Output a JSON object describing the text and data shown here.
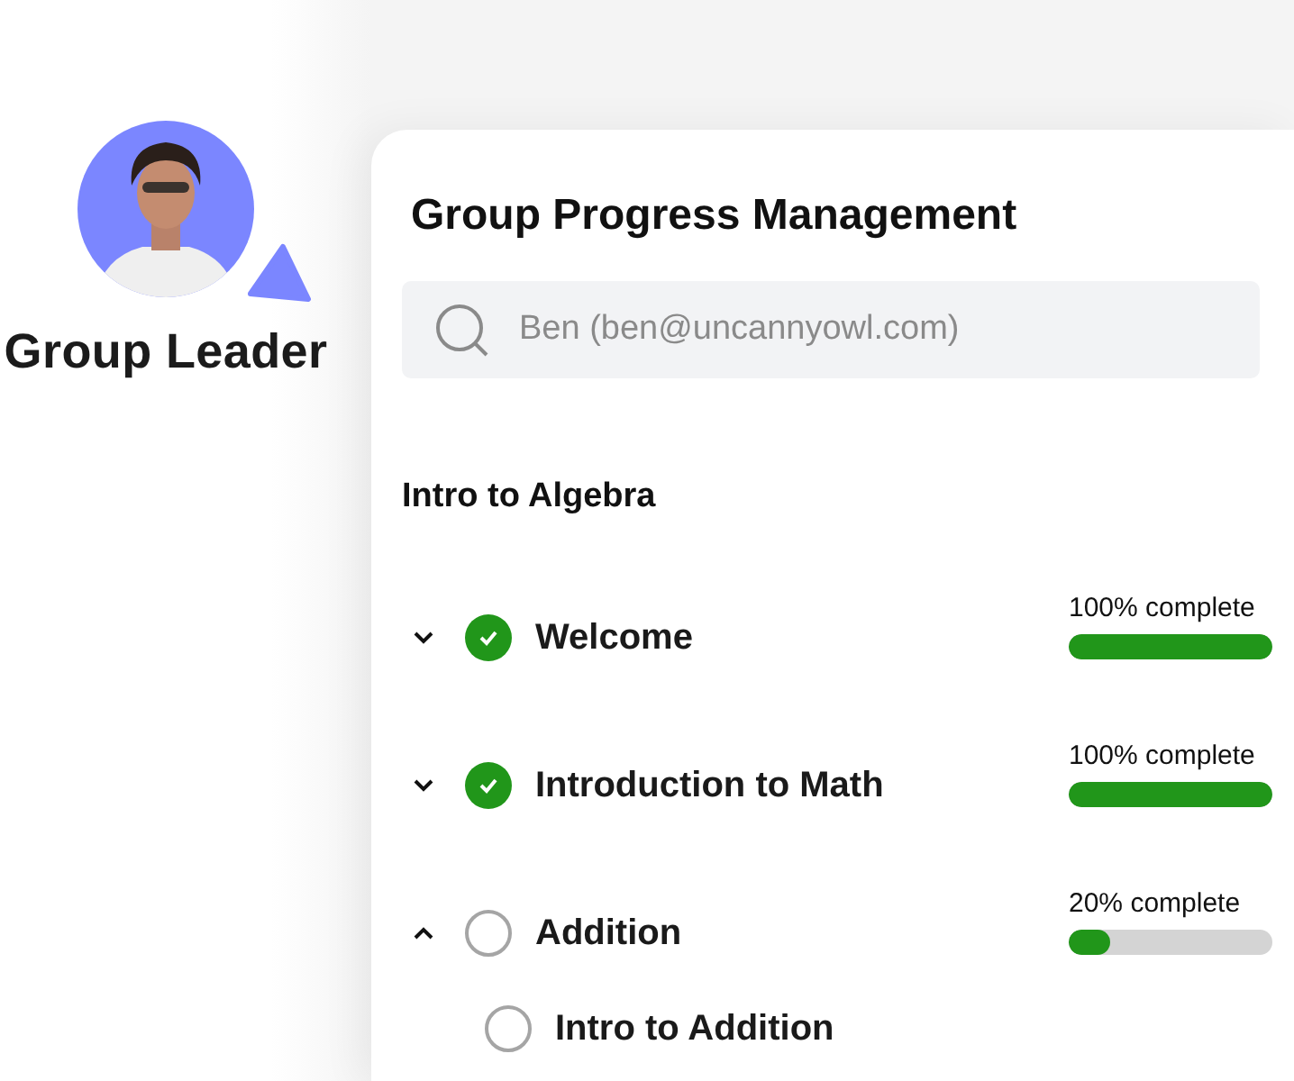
{
  "leader": {
    "label": "Group Leader"
  },
  "panel": {
    "title": "Group Progress Management",
    "search": {
      "value": "Ben (ben@uncannyowl.com)"
    },
    "course": "Intro to Algebra",
    "lessons": [
      {
        "title": "Welcome",
        "completed": true,
        "expanded": false,
        "progress": "100% complete",
        "level": 1.0
      },
      {
        "title": "Introduction to Math",
        "completed": true,
        "expanded": false,
        "progress": "100% complete",
        "level": 1.0
      },
      {
        "title": "Addition",
        "completed": false,
        "expanded": true,
        "progress": "20% complete",
        "level": 0.2,
        "children": [
          {
            "title": "Intro to Addition",
            "completed": false
          }
        ]
      }
    ]
  }
}
